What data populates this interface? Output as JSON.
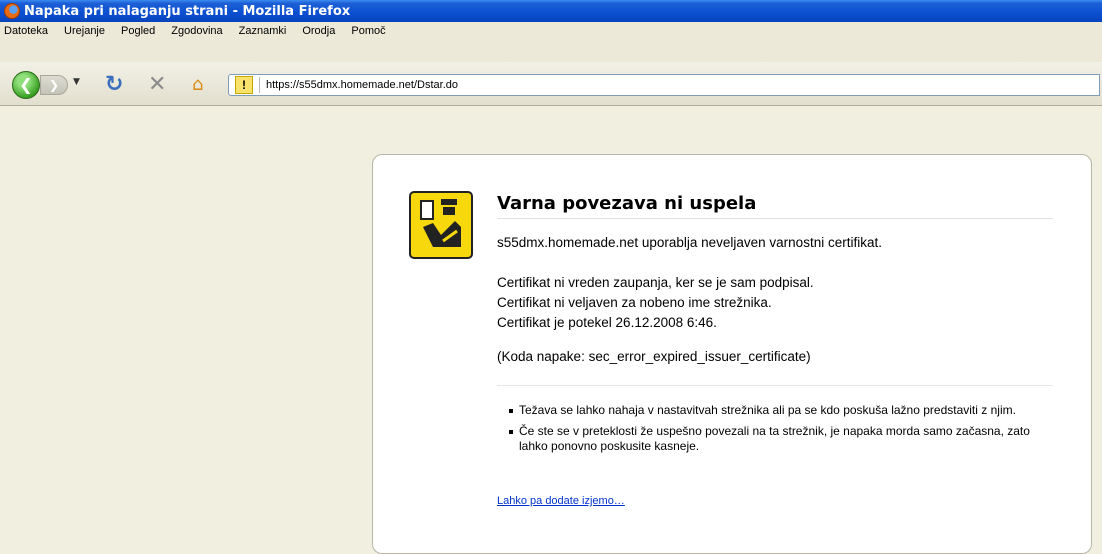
{
  "window": {
    "title": "Napaka pri nalaganju strani - Mozilla Firefox"
  },
  "menu": [
    "Datoteka",
    "Urejanje",
    "Pogled",
    "Zgodovina",
    "Zaznamki",
    "Orodja",
    "Pomoč"
  ],
  "nav": {
    "url": "https://s55dmx.homemade.net/Dstar.do"
  },
  "error": {
    "title": "Varna povezava ni uspela",
    "summary": "s55dmx.homemade.net uporablja neveljaven varnostni certifikat.",
    "reasons": [
      "Certifikat ni vreden zaupanja, ker se je sam podpisal.",
      "Certifikat ni veljaven za nobeno ime strežnika.",
      "Certifikat je potekel 26.12.2008 6:46."
    ],
    "code": "(Koda napake: sec_error_expired_issuer_certificate)",
    "tips": [
      "Težava se lahko nahaja v nastavitvah strežnika ali pa se kdo poskuša lažno predstaviti z njim.",
      "Če ste se v preteklosti že uspešno povezali na ta strežnik, je napaka morda samo začasna, zato lahko ponovno poskusite kasneje."
    ],
    "exception_link": "Lahko pa dodate izjemo…"
  }
}
